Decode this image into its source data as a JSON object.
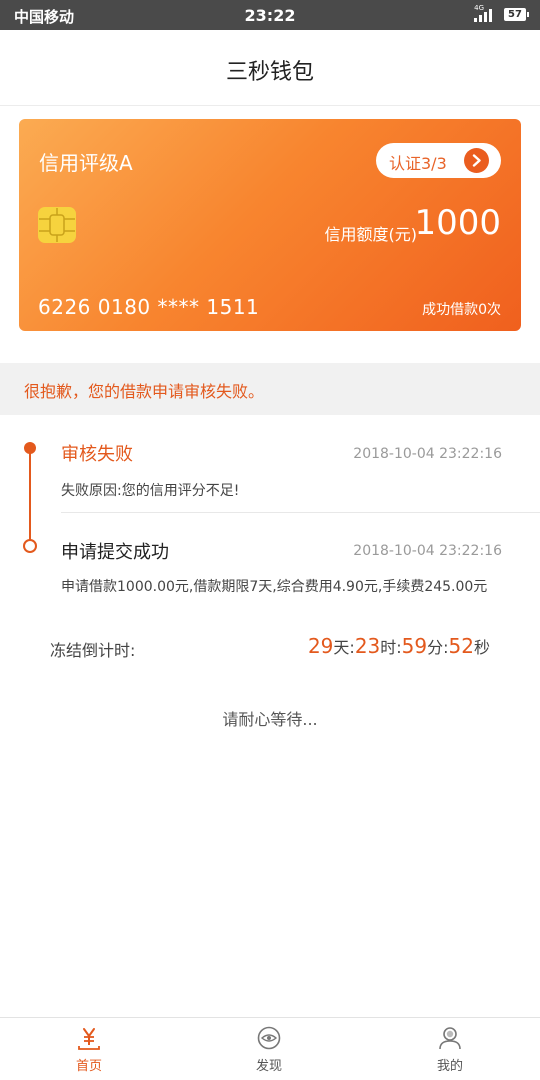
{
  "status_bar": {
    "carrier": "中国移动",
    "time": "23:22",
    "network": "4G",
    "battery": "57"
  },
  "header": {
    "title": "三秒钱包"
  },
  "card": {
    "rating": "信用评级A",
    "verify_label": "认证3/3",
    "limit_label": "信用额度(元)",
    "limit_value": "1000",
    "card_number": "6226 0180 **** 1511",
    "borrow_count": "成功借款0次",
    "colors": {
      "gradient_start": "#fbab52",
      "gradient_end": "#f0601e"
    }
  },
  "notice": {
    "text": "很抱歉，您的借款申请审核失败。"
  },
  "timeline": [
    {
      "title": "审核失败",
      "time": "2018-10-04 23:22:16",
      "description": "失败原因:您的信用评分不足!"
    },
    {
      "title": "申请提交成功",
      "time": "2018-10-04 23:22:16",
      "description": "申请借款1000.00元,借款期限7天,综合费用4.90元,手续费245.00元"
    }
  ],
  "countdown": {
    "label": "冻结倒计时:",
    "days": "29",
    "days_unit": "天:",
    "hours": "23",
    "hours_unit": "时:",
    "minutes": "59",
    "minutes_unit": "分:",
    "seconds": "52",
    "seconds_unit": "秒"
  },
  "wait_message": "请耐心等待...",
  "bottom_nav": {
    "items": [
      {
        "label": "首页",
        "icon": "yuan-icon",
        "active": true
      },
      {
        "label": "发现",
        "icon": "eye-icon",
        "active": false
      },
      {
        "label": "我的",
        "icon": "user-icon",
        "active": false
      }
    ]
  },
  "accent_color": "#e3591d"
}
